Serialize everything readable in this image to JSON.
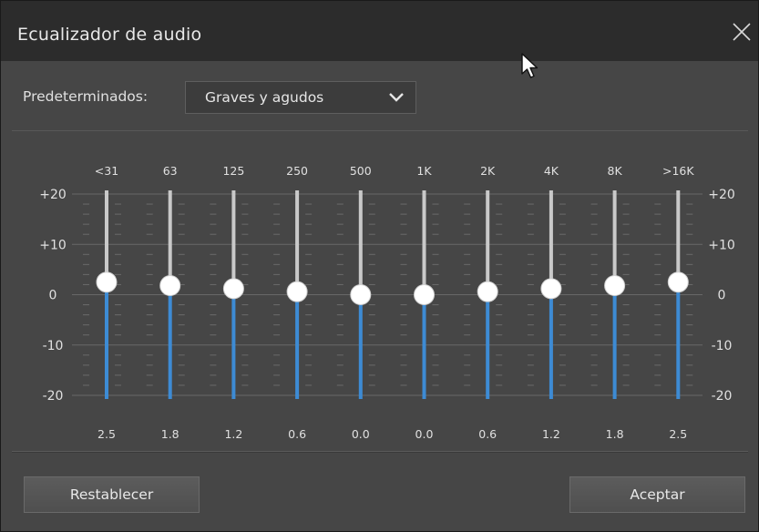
{
  "window": {
    "title": "Ecualizador de audio"
  },
  "presets": {
    "label": "Predeterminados:",
    "selected": "Graves y agudos"
  },
  "scale": {
    "left": [
      "+20",
      "+10",
      "0",
      "-10",
      "-20"
    ],
    "right": [
      "+20",
      "+10",
      "0",
      "-10",
      "-20"
    ],
    "min": -20,
    "max": 20
  },
  "bands": [
    {
      "label": "<31",
      "value_text": "2.5",
      "value": 2.5
    },
    {
      "label": "63",
      "value_text": "1.8",
      "value": 1.8
    },
    {
      "label": "125",
      "value_text": "1.2",
      "value": 1.2
    },
    {
      "label": "250",
      "value_text": "0.6",
      "value": 0.6
    },
    {
      "label": "500",
      "value_text": "0.0",
      "value": 0.0
    },
    {
      "label": "1K",
      "value_text": "0.0",
      "value": 0.0
    },
    {
      "label": "2K",
      "value_text": "0.6",
      "value": 0.6
    },
    {
      "label": "4K",
      "value_text": "1.2",
      "value": 1.2
    },
    {
      "label": "8K",
      "value_text": "1.8",
      "value": 1.8
    },
    {
      "label": ">16K",
      "value_text": "2.5",
      "value": 2.5
    }
  ],
  "buttons": {
    "reset": "Restablecer",
    "accept": "Aceptar"
  },
  "colors": {
    "accent": "#3d8bd4",
    "track": "#c9c9c9",
    "knob": "#ffffff"
  }
}
